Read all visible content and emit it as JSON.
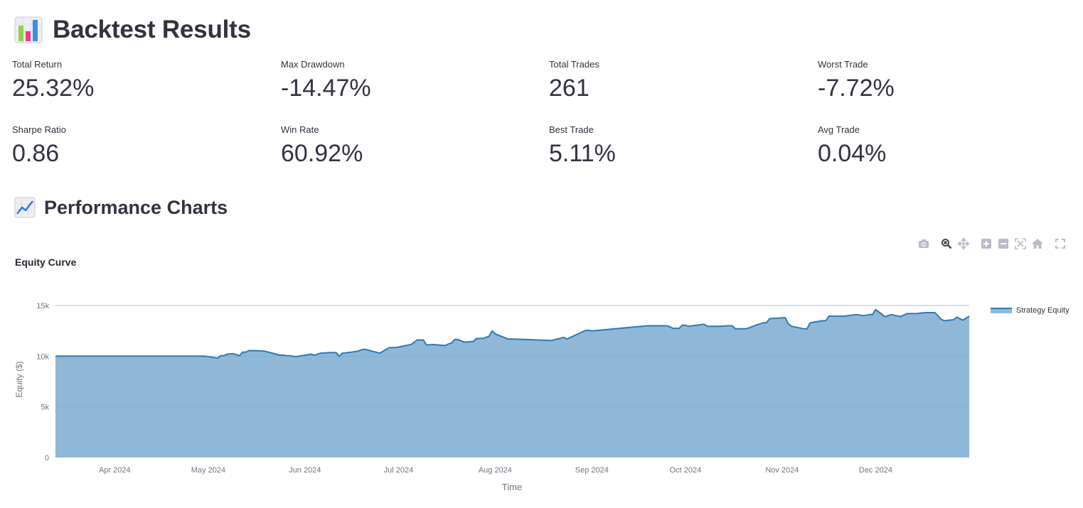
{
  "header": {
    "title": "Backtest Results",
    "icon": "bar-chart-emoji-icon"
  },
  "metrics": [
    {
      "label": "Total Return",
      "value": "25.32%"
    },
    {
      "label": "Max Drawdown",
      "value": "-14.47%"
    },
    {
      "label": "Total Trades",
      "value": "261"
    },
    {
      "label": "Worst Trade",
      "value": "-7.72%"
    },
    {
      "label": "Sharpe Ratio",
      "value": "0.86"
    },
    {
      "label": "Win Rate",
      "value": "60.92%"
    },
    {
      "label": "Best Trade",
      "value": "5.11%"
    },
    {
      "label": "Avg Trade",
      "value": "0.04%"
    }
  ],
  "section": {
    "title": "Performance Charts",
    "icon": "chart-increasing-emoji-icon"
  },
  "modebar": [
    "camera-icon",
    "zoom-icon",
    "pan-icon",
    "zoom-in-icon",
    "zoom-out-icon",
    "autoscale-icon",
    "home-icon",
    "fullscreen-icon"
  ],
  "colors": {
    "line": "#2e7ab5",
    "fill": "#8fb8d8",
    "grid": "#e8e8ec",
    "axis_text": "#707482"
  },
  "chart_data": {
    "type": "area",
    "title": "Equity Curve",
    "xlabel": "Time",
    "ylabel": "Equity ($)",
    "ylim": [
      0,
      15000
    ],
    "xlim": [
      "2024-03-13",
      "2024-12-31"
    ],
    "yticks": [
      0,
      5000,
      10000,
      15000
    ],
    "ytick_labels": [
      "0",
      "5k",
      "10k",
      "15k"
    ],
    "xticks": [
      "2024-04-01",
      "2024-05-01",
      "2024-06-01",
      "2024-07-01",
      "2024-08-01",
      "2024-09-01",
      "2024-10-01",
      "2024-11-01",
      "2024-12-01"
    ],
    "xtick_labels": [
      "Apr 2024",
      "May 2024",
      "Jun 2024",
      "Jul 2024",
      "Aug 2024",
      "Sep 2024",
      "Oct 2024",
      "Nov 2024",
      "Dec 2024"
    ],
    "grid": true,
    "legend_position": "right",
    "series": [
      {
        "name": "Strategy Equity",
        "x": [
          "2024-03-13",
          "2024-04-30",
          "2024-05-04",
          "2024-05-05",
          "2024-05-06",
          "2024-05-07",
          "2024-05-09",
          "2024-05-11",
          "2024-05-12",
          "2024-05-13",
          "2024-05-14",
          "2024-05-16",
          "2024-05-19",
          "2024-05-24",
          "2024-05-25",
          "2024-05-26",
          "2024-05-27",
          "2024-05-29",
          "2024-06-03",
          "2024-06-04",
          "2024-06-06",
          "2024-06-09",
          "2024-06-11",
          "2024-06-12",
          "2024-06-13",
          "2024-06-16",
          "2024-06-18",
          "2024-06-20",
          "2024-06-25",
          "2024-06-28",
          "2024-06-30",
          "2024-07-01",
          "2024-07-05",
          "2024-07-07",
          "2024-07-09",
          "2024-07-10",
          "2024-07-12",
          "2024-07-16",
          "2024-07-17",
          "2024-07-18",
          "2024-07-19",
          "2024-07-20",
          "2024-07-22",
          "2024-07-23",
          "2024-07-25",
          "2024-07-26",
          "2024-07-28",
          "2024-07-30",
          "2024-07-31",
          "2024-08-01",
          "2024-08-05",
          "2024-08-06",
          "2024-08-19",
          "2024-08-21",
          "2024-08-23",
          "2024-08-24",
          "2024-08-30",
          "2024-08-31",
          "2024-09-01",
          "2024-09-19",
          "2024-09-22",
          "2024-09-25",
          "2024-09-26",
          "2024-09-27",
          "2024-09-29",
          "2024-09-30",
          "2024-10-01",
          "2024-10-02",
          "2024-10-07",
          "2024-10-08",
          "2024-10-09",
          "2024-10-12",
          "2024-10-15",
          "2024-10-16",
          "2024-10-17",
          "2024-10-20",
          "2024-10-21",
          "2024-10-24",
          "2024-10-26",
          "2024-10-27",
          "2024-10-28",
          "2024-11-02",
          "2024-11-03",
          "2024-11-04",
          "2024-11-08",
          "2024-11-09",
          "2024-11-10",
          "2024-11-13",
          "2024-11-14",
          "2024-11-15",
          "2024-11-16",
          "2024-11-19",
          "2024-11-21",
          "2024-11-22",
          "2024-11-25",
          "2024-11-27",
          "2024-11-29",
          "2024-11-30",
          "2024-12-01",
          "2024-12-04",
          "2024-12-06",
          "2024-12-09",
          "2024-12-11",
          "2024-12-14",
          "2024-12-17",
          "2024-12-20",
          "2024-12-22",
          "2024-12-23",
          "2024-12-26",
          "2024-12-27",
          "2024-12-29",
          "2024-12-31"
        ],
        "y": [
          10000,
          10000,
          9800,
          10050,
          10050,
          10200,
          10250,
          10050,
          10400,
          10400,
          10550,
          10550,
          10500,
          10100,
          10100,
          10050,
          10050,
          9950,
          10200,
          10100,
          10300,
          10350,
          10350,
          10000,
          10300,
          10400,
          10500,
          10700,
          10300,
          10850,
          10850,
          10900,
          11150,
          11600,
          11600,
          11100,
          11150,
          11050,
          11200,
          11300,
          11650,
          11650,
          11400,
          11400,
          11450,
          11750,
          11750,
          11950,
          12500,
          12200,
          11700,
          11700,
          11550,
          11700,
          11850,
          11700,
          12550,
          12550,
          12500,
          13000,
          13000,
          13000,
          12900,
          12750,
          12750,
          13050,
          13050,
          12950,
          13150,
          12950,
          12950,
          12950,
          13000,
          13000,
          12700,
          12700,
          12750,
          13100,
          13300,
          13300,
          13700,
          13800,
          13200,
          12950,
          12700,
          12700,
          13300,
          13450,
          13500,
          13500,
          13950,
          13950,
          13950,
          14000,
          14100,
          14000,
          14100,
          14100,
          14600,
          13900,
          14100,
          13900,
          14200,
          14200,
          14300,
          14300,
          13650,
          13500,
          13600,
          13850,
          13550,
          13950
        ]
      }
    ]
  }
}
